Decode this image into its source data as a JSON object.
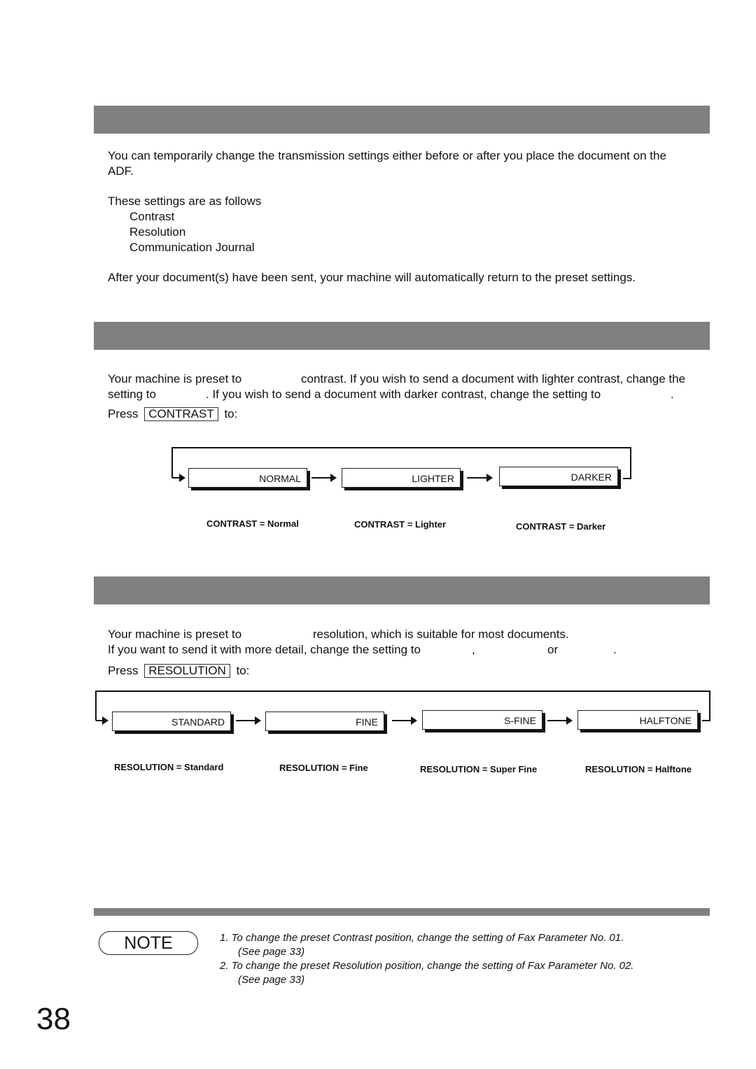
{
  "intro": {
    "line1": "You can temporarily change the transmission settings either before or after you place the document on the",
    "line2": "ADF.",
    "list_title": "These settings are as follows",
    "items": [
      "Contrast",
      "Resolution",
      "Communication Journal"
    ],
    "after": "After your document(s) have been sent, your machine will automatically return to the preset settings."
  },
  "contrast": {
    "line1a": "Your machine is preset to",
    "line1b": "contrast. If you wish to send a document with lighter contrast, change the",
    "line2a": "setting to",
    "line2b": ". If you wish to send a document with darker contrast, change the setting to",
    "line2c": ".",
    "press": "Press",
    "key": "CONTRAST",
    "to": "to:",
    "states": [
      "NORMAL",
      "LIGHTER",
      "DARKER"
    ],
    "captions": [
      "CONTRAST = Normal",
      "CONTRAST = Lighter",
      "CONTRAST = Darker"
    ]
  },
  "resolution": {
    "line1a": "Your machine is preset to",
    "line1b": "resolution, which is suitable for most documents.",
    "line2a": "If you want to send it with more detail, change the setting to",
    "line2b": ",",
    "line2c": "or",
    "line2d": ".",
    "press": "Press",
    "key": "RESOLUTION",
    "to": "to:",
    "states": [
      "STANDARD",
      "FINE",
      "S-FINE",
      "HALFTONE"
    ],
    "captions": [
      "RESOLUTION = Standard",
      "RESOLUTION = Fine",
      "RESOLUTION = Super Fine",
      "RESOLUTION = Halftone"
    ]
  },
  "note": {
    "label": "NOTE",
    "items": [
      {
        "text": "1.  To change the preset Contrast position, change the setting of Fax Parameter No. 01.",
        "ref": "(See page 33)"
      },
      {
        "text": "2.  To change the preset Resolution position, change the setting of Fax Parameter No. 02.",
        "ref": "(See page 33)"
      }
    ]
  },
  "page_number": "38"
}
